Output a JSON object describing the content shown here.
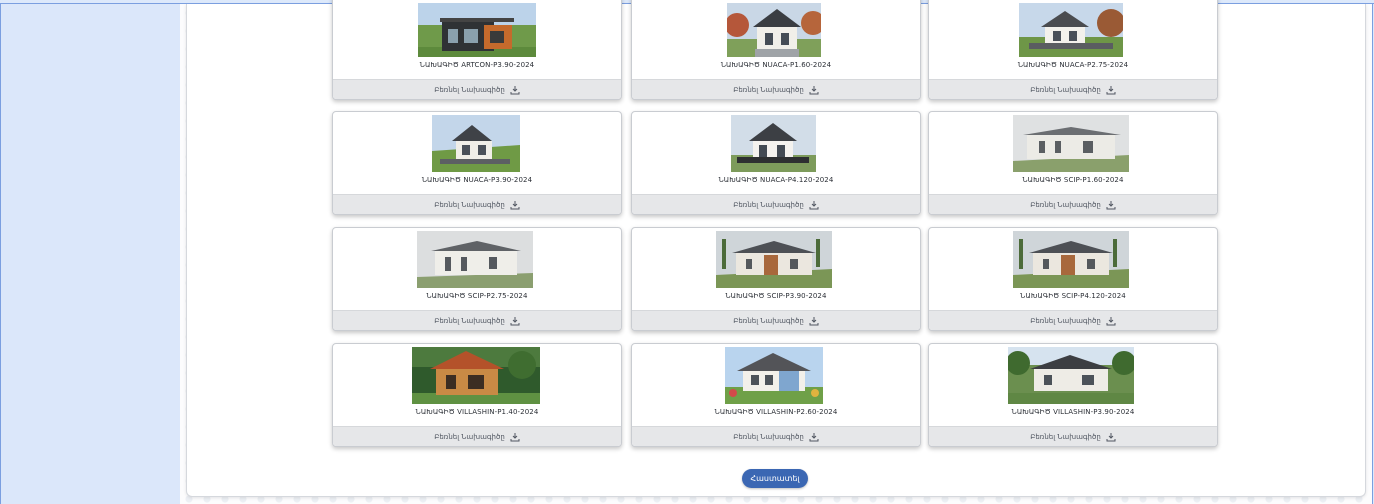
{
  "cards": [
    {
      "title": "ՆԱԽԱԳԻԾ ARTCON-P3.90-2024",
      "download_label": "Բեռնել Նախագիծը",
      "icon": "download-icon"
    },
    {
      "title": "ՆԱԽԱԳԻԾ NUACA-P1.60-2024",
      "download_label": "Բեռնել Նախագիծը",
      "icon": "download-icon"
    },
    {
      "title": "ՆԱԽԱԳԻԾ NUACA-P2.75-2024",
      "download_label": "Բեռնել Նախագիծը",
      "icon": "download-icon"
    },
    {
      "title": "ՆԱԽԱԳԻԾ NUACA-P3.90-2024",
      "download_label": "Բեռնել Նախագիծը",
      "icon": "download-icon"
    },
    {
      "title": "ՆԱԽԱԳԻԾ NUACA-P4.120-2024",
      "download_label": "Բեռնել Նախագիծը",
      "icon": "download-icon"
    },
    {
      "title": "ՆԱԽԱԳԻԾ SCIP-P1.60-2024",
      "download_label": "Բեռնել Նախագիծը",
      "icon": "download-icon"
    },
    {
      "title": "ՆԱԽԱԳԻԾ SCIP-P2.75-2024",
      "download_label": "Բեռնել Նախագիծը",
      "icon": "download-icon"
    },
    {
      "title": "ՆԱԽԱԳԻԾ SCIP-P3.90-2024",
      "download_label": "Բեռնել Նախագիծը",
      "icon": "download-icon"
    },
    {
      "title": "ՆԱԽԱԳԻԾ SCIP-P4.120-2024",
      "download_label": "Բեռնել Նախագիծը",
      "icon": "download-icon"
    },
    {
      "title": "ՆԱԽԱԳԻԾ VILLASHIN-P1.40-2024",
      "download_label": "Բեռնել Նախագիծը",
      "icon": "download-icon"
    },
    {
      "title": "ՆԱԽԱԳԻԾ VILLASHIN-P2.60-2024",
      "download_label": "Բեռնել Նախագիծը",
      "icon": "download-icon"
    },
    {
      "title": "ՆԱԽԱԳԻԾ VILLASHIN-P3.90-2024",
      "download_label": "Բեռնել Նախագիծը",
      "icon": "download-icon"
    }
  ],
  "back_button": {
    "label": "Հաստատել"
  },
  "colors": {
    "accent": "#3b67b3",
    "sidebar": "#dbe7fa",
    "card_footer": "#e6e7e9"
  }
}
